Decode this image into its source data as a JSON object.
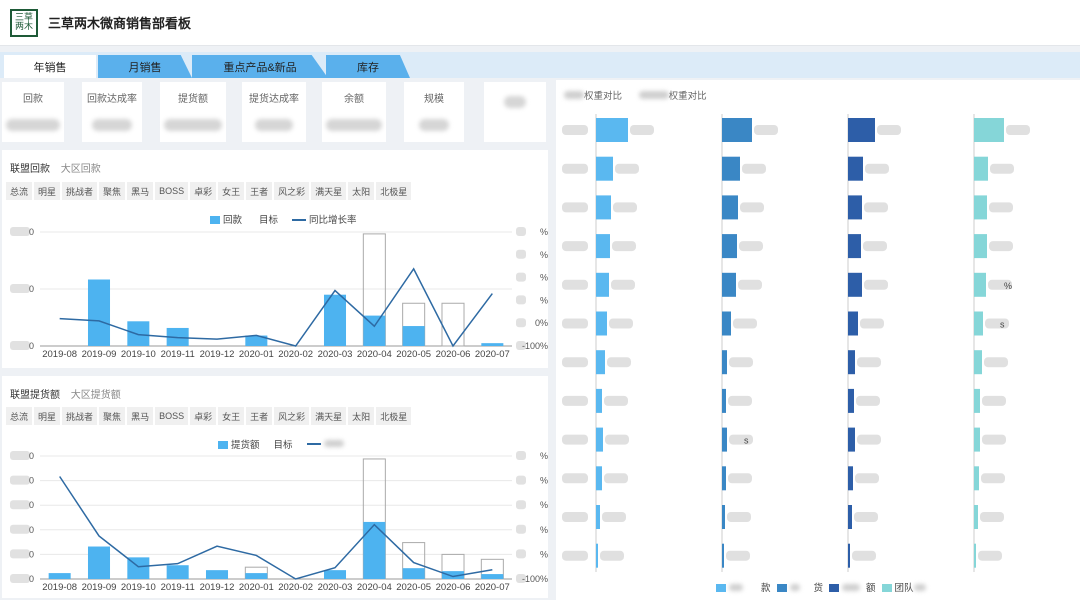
{
  "app": {
    "logo_text": "三草两木",
    "title": "三草两木微商销售部看板"
  },
  "tabs": [
    {
      "label": "年销售",
      "active": true
    },
    {
      "label": "月销售",
      "active": false
    },
    {
      "label": "重点产品&新品",
      "active": false
    },
    {
      "label": "库存",
      "active": false
    }
  ],
  "kpis": [
    "回款",
    "回款达成率",
    "提货额",
    "提货达成率",
    "余额",
    "规模",
    ""
  ],
  "filters": [
    "总流",
    "明星",
    "挑战者",
    "聚焦",
    "黑马",
    "BOSS",
    "卓彩",
    "女王",
    "王者",
    "风之彩",
    "满天星",
    "太阳",
    "北极星"
  ],
  "chart1": {
    "subtabs": [
      "联盟回款",
      "大区回款"
    ],
    "legend": {
      "bar": "回款",
      "target": "目标",
      "line": "同比增长率"
    },
    "right_ticks": [
      "%",
      "%",
      "%",
      "%",
      "0%",
      "-100%"
    ],
    "left_ticks": [
      "0",
      "0",
      "0"
    ]
  },
  "chart2": {
    "subtabs": [
      "联盟提货额",
      "大区提货额"
    ],
    "legend": {
      "bar": "提货额",
      "target": "目标"
    },
    "right_ticks": [
      "%",
      "%",
      "%",
      "%",
      "%",
      "-100%"
    ],
    "left_ticks": [
      "0",
      "0",
      "0",
      "0",
      "0",
      "0"
    ]
  },
  "right_panel": {
    "subtabs": [
      "权重对比",
      "权重对比"
    ],
    "legend": [
      "款",
      "货",
      "额",
      "团队"
    ],
    "col4_values": [
      "%",
      "s"
    ],
    "col2_value": "s"
  },
  "chart_data": [
    {
      "type": "bar",
      "title": "",
      "categories": [
        "2019-08",
        "2019-09",
        "2019-10",
        "2019-11",
        "2019-12",
        "2020-01",
        "2020-02",
        "2020-03",
        "2020-04",
        "2020-05",
        "2020-06",
        "2020-07"
      ],
      "series": [
        {
          "name": "回款",
          "values": [
            0,
            70,
            26,
            19,
            0,
            11,
            0,
            54,
            32,
            21,
            0,
            3
          ]
        },
        {
          "name": "目标",
          "values": [
            0,
            0,
            0,
            0,
            0,
            0,
            0,
            0,
            118,
            45,
            45,
            0
          ]
        },
        {
          "name": "同比增长率",
          "values": [
            -28,
            -34,
            -70,
            -78,
            -82,
            -72,
            -100,
            46,
            -48,
            103,
            -100,
            38
          ]
        }
      ],
      "ylim": [
        0,
        120
      ],
      "y2lim": [
        -100,
        200
      ]
    },
    {
      "type": "bar",
      "title": "",
      "categories": [
        "2019-08",
        "2019-09",
        "2019-10",
        "2019-11",
        "2019-12",
        "2020-01",
        "2020-02",
        "2020-03",
        "2020-04",
        "2020-05",
        "2020-06",
        "2020-07"
      ],
      "series": [
        {
          "name": "提货额",
          "values": [
            6,
            33,
            22,
            14,
            9,
            6,
            0,
            9,
            58,
            11,
            8,
            5
          ]
        },
        {
          "name": "目标",
          "values": [
            0,
            0,
            0,
            0,
            0,
            12,
            0,
            0,
            122,
            37,
            25,
            20
          ]
        },
        {
          "name": "line",
          "values": [
            400,
            110,
            -40,
            -25,
            60,
            15,
            -100,
            -45,
            165,
            -20,
            -88,
            -55
          ]
        }
      ],
      "ylim": [
        0,
        125
      ],
      "y2lim": [
        -100,
        500
      ]
    }
  ],
  "rank_bars": {
    "columns": [
      {
        "color": "#5ab8f0",
        "values": [
          32,
          17,
          15,
          14,
          13,
          11,
          9,
          6,
          7,
          6,
          4,
          2
        ]
      },
      {
        "color": "#3a87c5",
        "values": [
          30,
          18,
          16,
          15,
          14,
          9,
          5,
          4,
          5,
          4,
          3,
          2
        ]
      },
      {
        "color": "#2d5ea8",
        "values": [
          27,
          15,
          14,
          13,
          14,
          10,
          7,
          6,
          7,
          5,
          4,
          2
        ]
      },
      {
        "color": "#85d6d8",
        "values": [
          30,
          14,
          13,
          13,
          12,
          9,
          8,
          6,
          6,
          5,
          4,
          2
        ]
      }
    ]
  }
}
